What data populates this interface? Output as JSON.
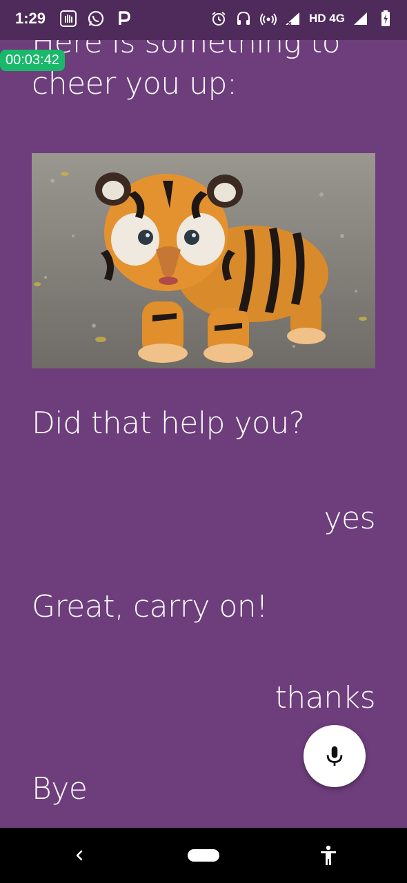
{
  "status_bar": {
    "time": "1:29",
    "network": "HD 4G"
  },
  "recording": {
    "timer": "00:03:42"
  },
  "chat": {
    "messages": [
      {
        "sender": "bot",
        "text": "Here is something to cheer you up:"
      },
      {
        "sender": "bot",
        "text": "Did that help you?"
      },
      {
        "sender": "user",
        "text": "yes"
      },
      {
        "sender": "bot",
        "text": "Great, carry on!"
      },
      {
        "sender": "user",
        "text": "thanks"
      },
      {
        "sender": "bot",
        "text": "Bye"
      }
    ]
  },
  "colors": {
    "background": "#6e3e7c",
    "status_bar": "#4f2b5b",
    "timer_badge": "#19b86a",
    "mic_button": "#ffffff"
  },
  "icons": {
    "mic": "microphone-icon",
    "back": "back-icon",
    "home": "home-pill",
    "accessibility": "accessibility-icon"
  }
}
